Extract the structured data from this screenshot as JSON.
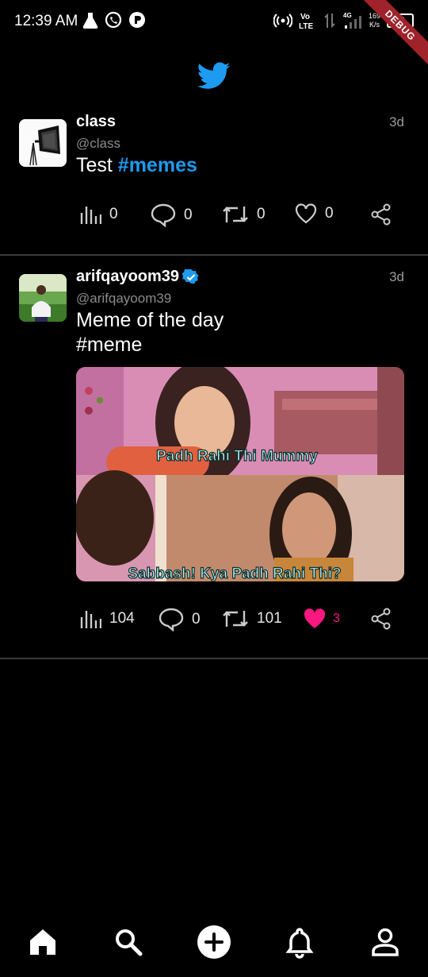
{
  "status_bar": {
    "time": "12:39 AM",
    "speed": "169",
    "speed_unit": "K/s",
    "network": "4G",
    "battery": "32",
    "debug_label": "DEBUG"
  },
  "tweets": [
    {
      "name": "class",
      "handle": "@class",
      "time_ago": "3d",
      "text_prefix": "Test ",
      "hashtag": "#memes",
      "views": "0",
      "replies": "0",
      "retweets": "0",
      "likes": "0"
    },
    {
      "name": "arifqayoom39",
      "handle": "@arifqayoom39",
      "time_ago": "3d",
      "text_line1": "Meme of the day",
      "text_line2": "#meme",
      "caption_top": "Padh Rahi Thi Mummy",
      "caption_bottom": "Sabbash! Kya Padh Rahi Thi?",
      "views": "104",
      "replies": "0",
      "retweets": "101",
      "likes": "3"
    }
  ],
  "colors": {
    "accent": "#1d9bf0",
    "like_active": "#f91880",
    "background": "#000000"
  },
  "nav": [
    "home-icon",
    "search-icon",
    "add-icon",
    "bell-icon",
    "profile-icon"
  ]
}
